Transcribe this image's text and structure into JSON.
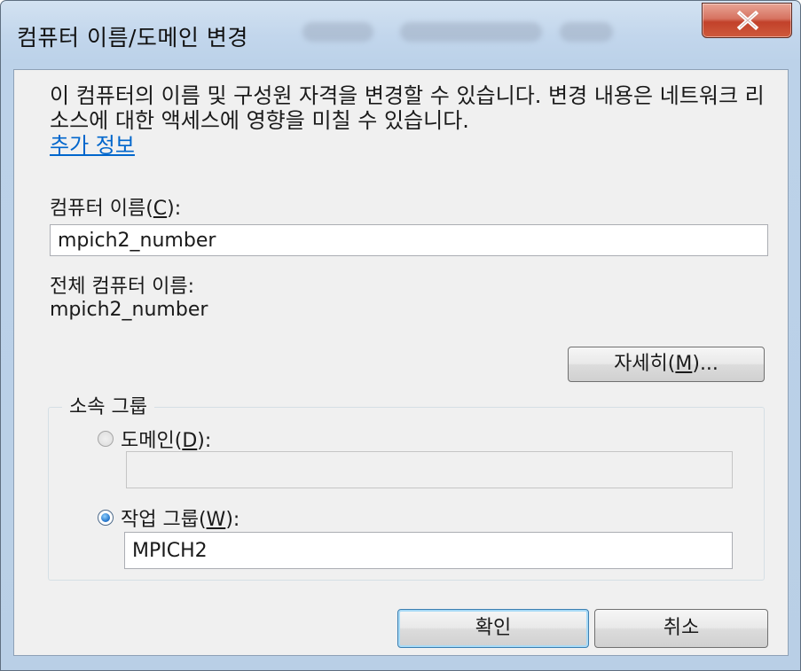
{
  "window": {
    "title": "컴퓨터 이름/도메인 변경",
    "close_glyph": "X"
  },
  "description": {
    "text": "이 컴퓨터의 이름 및 구성원 자격을 변경할 수 있습니다. 변경 내용은 네트워크 리소스에 대한 액세스에 영향을 미칠 수 있습니다.",
    "link": "추가 정보"
  },
  "computer_name": {
    "label_before": "컴퓨터 이름(",
    "label_key": "C",
    "label_after": "):",
    "value": "mpich2_number"
  },
  "full_name": {
    "label": "전체 컴퓨터 이름:",
    "value": "mpich2_number"
  },
  "more_button": {
    "label_before": "자세히(",
    "label_key": "M",
    "label_after": ")..."
  },
  "membership": {
    "group_label": "소속 그룹",
    "domain": {
      "label_before": "도메인(",
      "label_key": "D",
      "label_after": "):",
      "value": "",
      "selected": false
    },
    "workgroup": {
      "label_before": "작업 그룹(",
      "label_key": "W",
      "label_after": "):",
      "value": "MPICH2",
      "selected": true
    }
  },
  "buttons": {
    "ok": "확인",
    "cancel": "취소"
  },
  "colors": {
    "close_button": "#c7482e",
    "link": "#0066cc",
    "dialog_background": "#f0f0f0",
    "frame": "#bcd2e9"
  }
}
